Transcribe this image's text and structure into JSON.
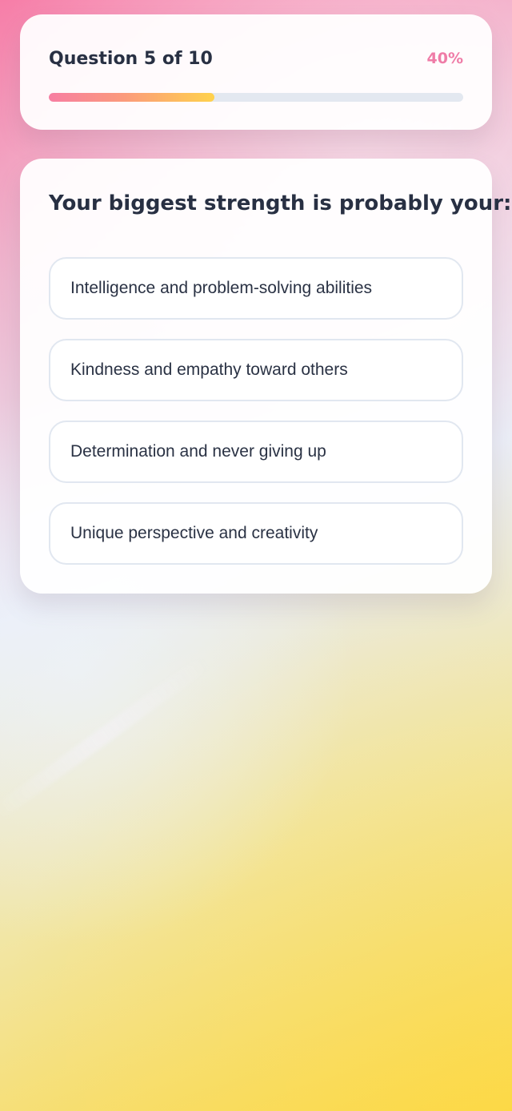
{
  "progress": {
    "label": "Question 5 of 10",
    "percent_text": "40%",
    "value": 0.4
  },
  "question": {
    "title": "Your biggest strength is probably your:",
    "options": [
      {
        "label": "Intelligence and problem-solving abilities"
      },
      {
        "label": "Kindness and empathy toward others"
      },
      {
        "label": "Determination and never giving up"
      },
      {
        "label": "Unique perspective and creativity"
      }
    ]
  },
  "colors": {
    "accent_pink": "#ef7ca7",
    "accent_yellow": "#ffd24c",
    "text_dark": "#283043",
    "border_light": "#e1e7f0"
  }
}
